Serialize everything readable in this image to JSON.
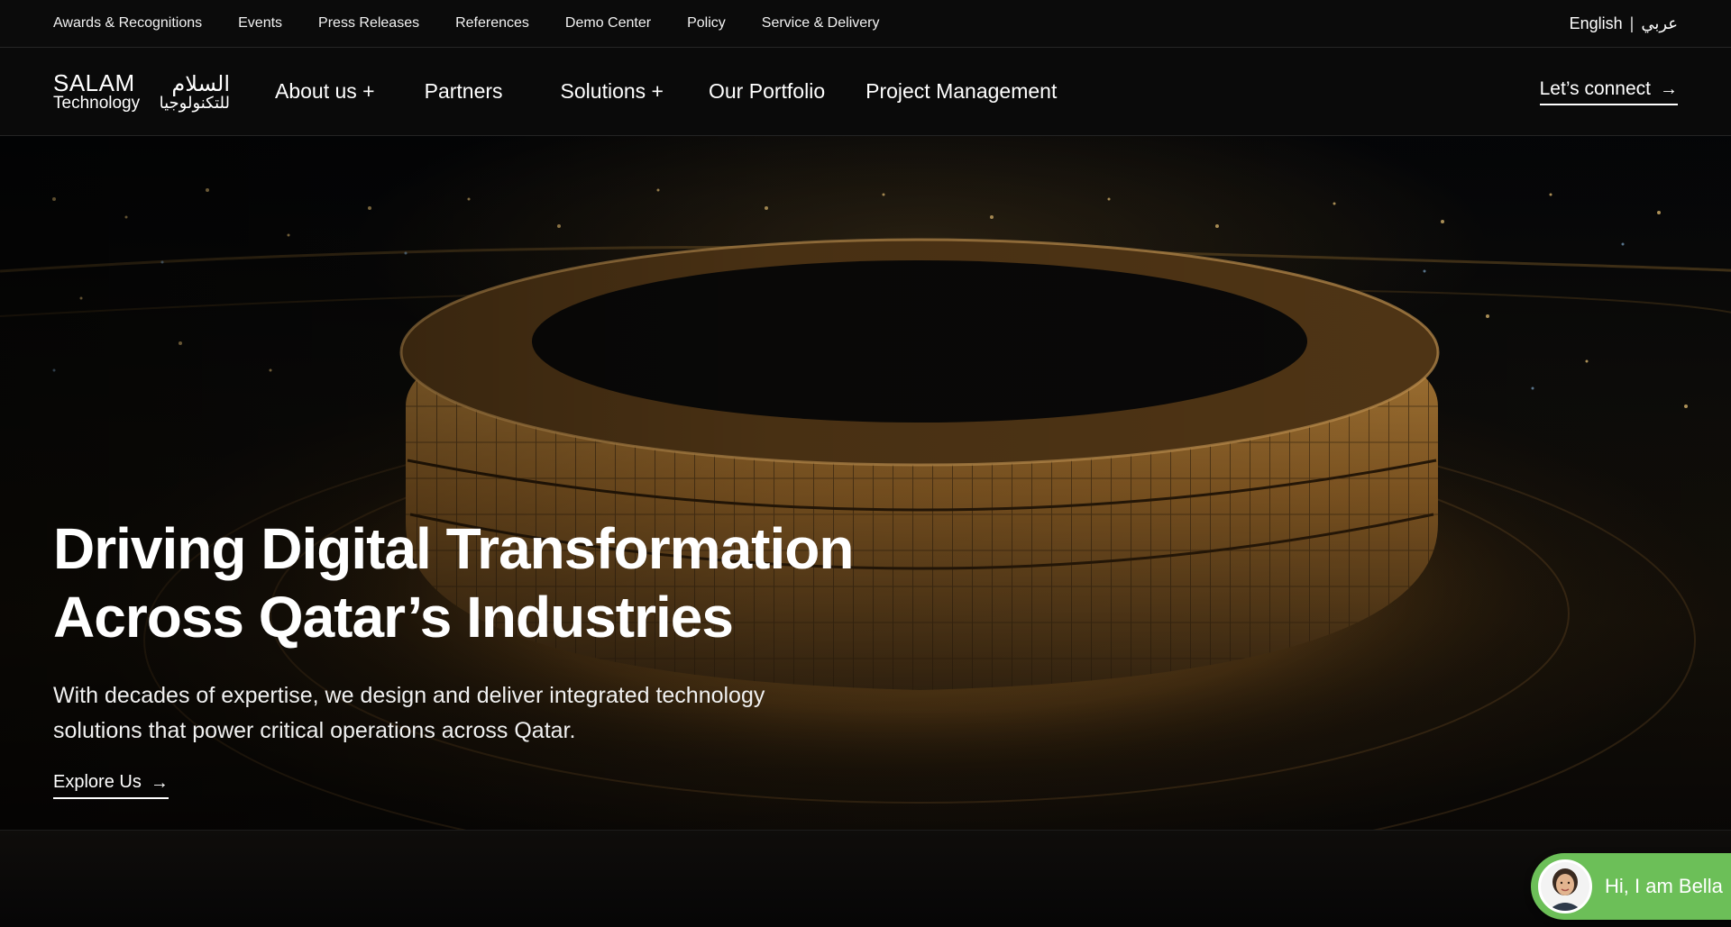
{
  "utility_bar": {
    "links": [
      "Awards & Recognitions",
      "Events",
      "Press Releases",
      "References",
      "Demo Center",
      "Policy",
      "Service & Delivery"
    ],
    "lang_en": "English",
    "lang_separator": "|",
    "lang_ar": "عربي"
  },
  "logo": {
    "en_top": "SALAM",
    "ar_top": "السلام",
    "en_bottom": "Technology",
    "ar_bottom": "للتكنولوجيا"
  },
  "main_nav": {
    "links": [
      "About us +",
      "Partners",
      "Solutions +",
      "Our Portfolio",
      "Project Management"
    ],
    "connect_label": "Let’s connect"
  },
  "hero": {
    "title_line1": "Driving Digital Transformation",
    "title_line2": "Across Qatar’s Industries",
    "subtitle": "With decades of expertise, we design and deliver integrated technology solutions that power critical operations across Qatar.",
    "cta_label": "Explore Us"
  },
  "chat": {
    "greeting": "Hi, I am Bella",
    "color": "#6cbf58"
  },
  "icons": {
    "arrow": "→",
    "connect_icon": "arrow-right-icon",
    "explore_icon": "arrow-right-icon"
  }
}
